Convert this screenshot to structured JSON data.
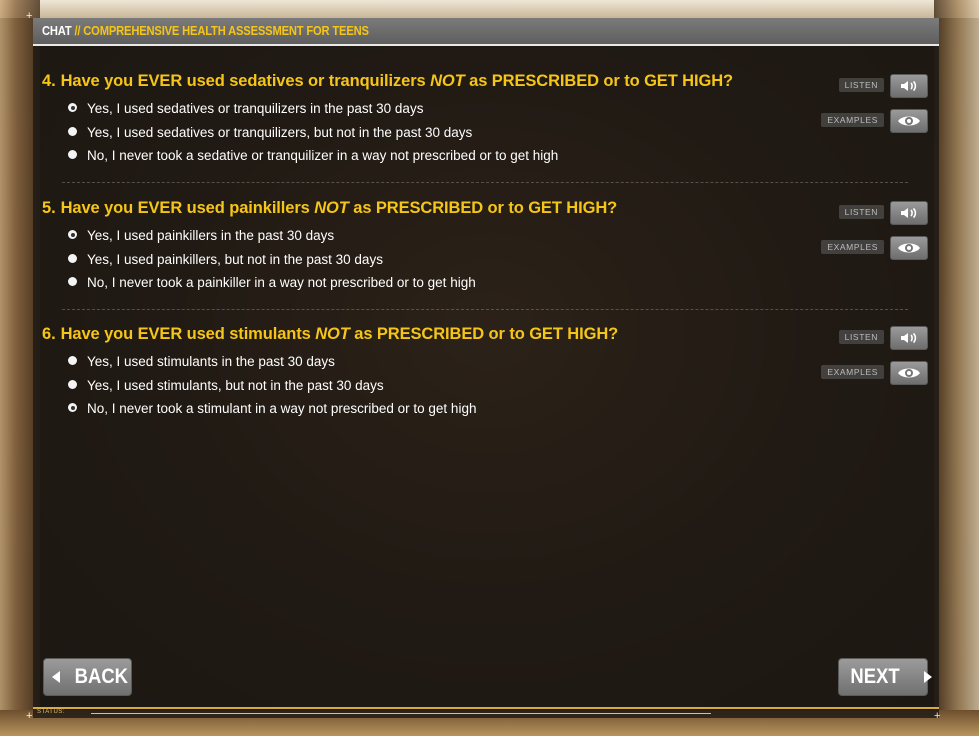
{
  "header": {
    "title_prefix": "CHAT",
    "title_sep": " // ",
    "title_main": "COMPREHENSIVE HEALTH ASSESSMENT FOR TEENS"
  },
  "side_buttons": {
    "listen_label": "LISTEN",
    "examples_label": "EXAMPLES",
    "listen_icon": "speaker-icon",
    "examples_icon": "eye-icon"
  },
  "questions": [
    {
      "number": "4.",
      "text_a": "Have you EVER used sedatives or tranquilizers ",
      "text_em": "NOT",
      "text_b": " as PRESCRIBED or to GET HIGH?",
      "options": [
        {
          "label": "Yes, I used sedatives or tranquilizers in the past 30 days",
          "selected": true
        },
        {
          "label": "Yes, I used sedatives or tranquilizers, but not in the past 30 days",
          "selected": false
        },
        {
          "label": "No, I never took a sedative or tranquilizer in a way not prescribed or to get high",
          "selected": false
        }
      ]
    },
    {
      "number": "5.",
      "text_a": "Have you EVER used painkillers ",
      "text_em": "NOT",
      "text_b": " as PRESCRIBED or to GET HIGH?",
      "options": [
        {
          "label": "Yes, I used painkillers in the past 30 days",
          "selected": true
        },
        {
          "label": "Yes, I used painkillers, but not in the past 30 days",
          "selected": false
        },
        {
          "label": "No, I never took a painkiller in a way not prescribed or to get high",
          "selected": false
        }
      ]
    },
    {
      "number": "6.",
      "text_a": "Have you EVER used stimulants ",
      "text_em": "NOT",
      "text_b": " as PRESCRIBED or to GET HIGH?",
      "options": [
        {
          "label": "Yes, I used stimulants in the past 30 days",
          "selected": false
        },
        {
          "label": "Yes, I used stimulants, but not in the past 30 days",
          "selected": false
        },
        {
          "label": "No, I never took a stimulant in a way not prescribed or to get high",
          "selected": true
        }
      ]
    }
  ],
  "nav": {
    "back_label": "BACK",
    "next_label": "NEXT"
  },
  "status": {
    "label": "STATUS:"
  },
  "colors": {
    "accent": "#f5c518",
    "text": "#ffffff"
  }
}
